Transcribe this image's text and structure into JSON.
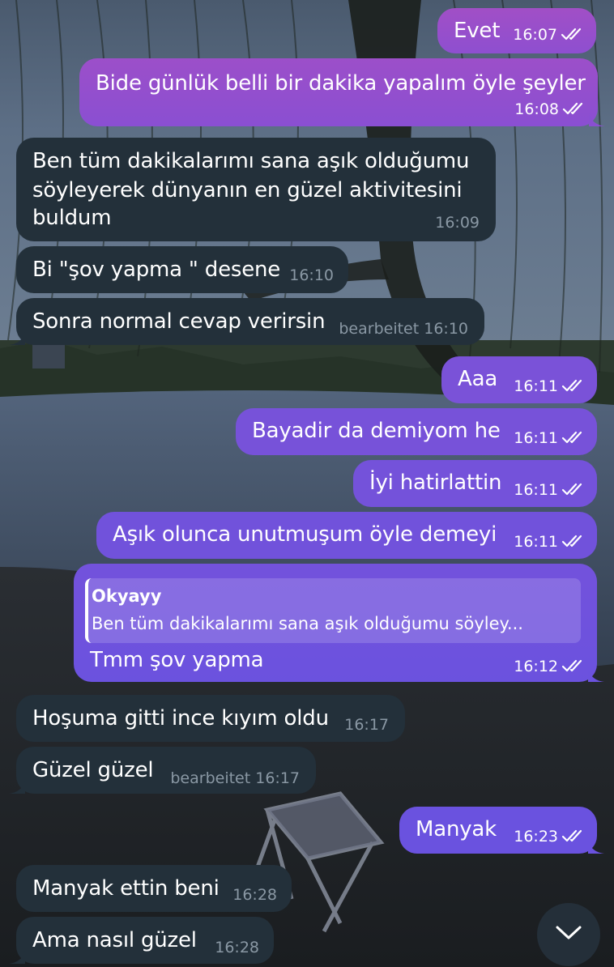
{
  "colors": {
    "incoming_bubble": "#23303a",
    "outgoing_gradient_top": "#9b4fc9",
    "outgoing_gradient_bottom": "#6a4fe0",
    "meta_incoming": "#8a98a4"
  },
  "messages": [
    {
      "text": "Evet",
      "time": "16:07",
      "dir": "out",
      "read": true
    },
    {
      "text": "Bide günlük belli bir dakika yapalım öyle şeyler",
      "time": "16:08",
      "dir": "out",
      "read": true
    },
    {
      "lines": [
        "Ben tüm dakikalarımı sana aşık olduğumu",
        "söyleyerek dünyanın en güzel aktivitesini",
        "buldum"
      ],
      "time": "16:09",
      "dir": "in"
    },
    {
      "text": "Bi \"şov yapma \" desene",
      "time": "16:10",
      "dir": "in"
    },
    {
      "text": "Sonra normal cevap verirsin",
      "time": "bearbeitet 16:10",
      "dir": "in"
    },
    {
      "text": "Aaa",
      "time": "16:11",
      "dir": "out",
      "read": true
    },
    {
      "text": "Bayadir da demiyom he",
      "time": "16:11",
      "dir": "out",
      "read": true
    },
    {
      "text": "İyi hatirlattin",
      "time": "16:11",
      "dir": "out",
      "read": true
    },
    {
      "text": "Aşık olunca unutmuşum öyle demeyi",
      "time": "16:11",
      "dir": "out",
      "read": true
    },
    {
      "reply": {
        "name": "Okyayy",
        "text": "Ben tüm dakikalarımı sana aşık olduğumu söyley..."
      },
      "text": "Tmm şov yapma",
      "time": "16:12",
      "dir": "out",
      "read": true
    },
    {
      "text": "Hoşuma gitti ince kıyım oldu",
      "time": "16:17",
      "dir": "in"
    },
    {
      "text": "Güzel güzel",
      "time": "bearbeitet 16:17",
      "dir": "in"
    },
    {
      "text": "Manyak",
      "time": "16:23",
      "dir": "out",
      "read": true
    },
    {
      "text": "Manyak ettin beni",
      "time": "16:28",
      "dir": "in"
    },
    {
      "text": "Ama nasıl güzel",
      "time": "16:28",
      "dir": "in"
    }
  ],
  "scroll_down_icon": "chevron-down-icon",
  "read_receipt_icon": "double-check-icon"
}
